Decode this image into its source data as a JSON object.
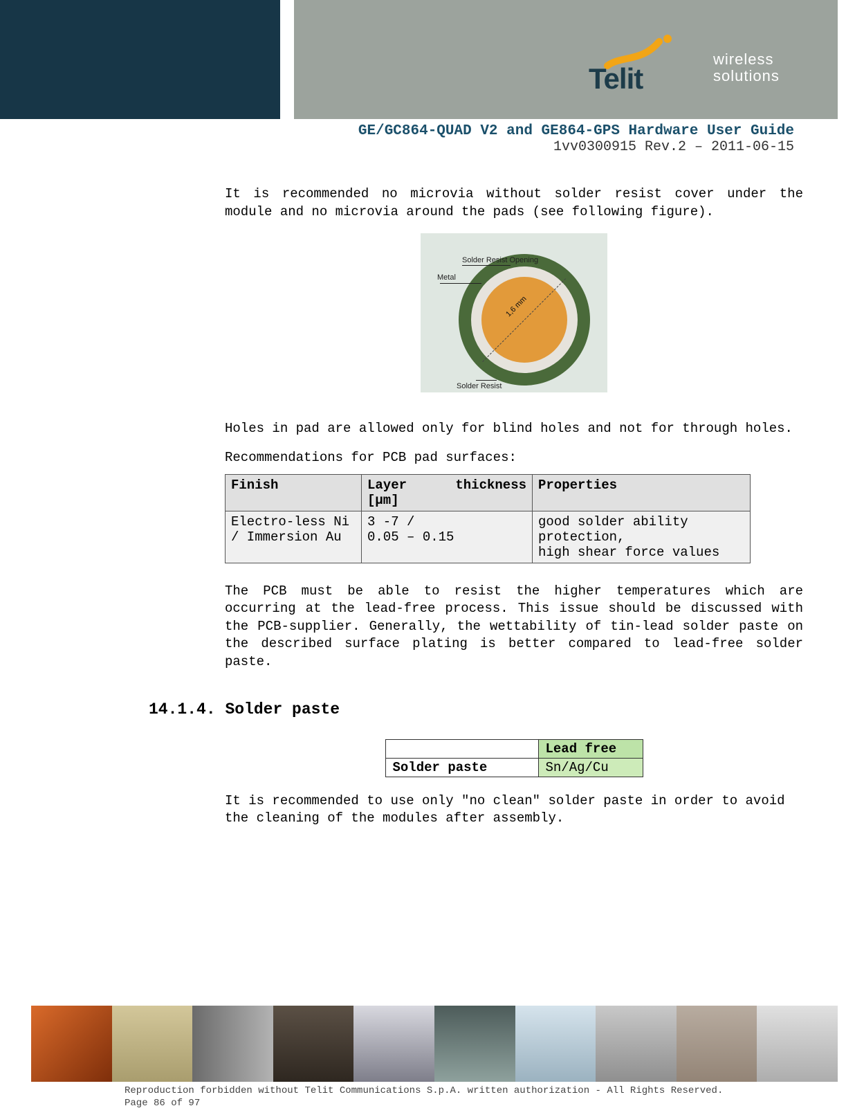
{
  "header": {
    "brand_name": "Telit",
    "brand_tag_line1": "wireless",
    "brand_tag_line2": "solutions",
    "doc_title": "GE/GC864-QUAD V2 and GE864-GPS Hardware User Guide",
    "doc_rev": "1vv0300915 Rev.2 – 2011-06-15"
  },
  "body": {
    "para1": "It is recommended no microvia without solder resist cover under the module and no microvia around the pads (see following figure).",
    "figure": {
      "label_sro": "Solder Resist Opening",
      "label_metal": "Metal",
      "label_sr": "Solder Resist",
      "dimension": "1,6 mm"
    },
    "para2": "Holes in pad are allowed only for blind holes and not for through holes.",
    "para3": "Recommendations for PCB pad surfaces:",
    "table1": {
      "headers": {
        "finish": "Finish",
        "thickness": "Layer thickness [µm]",
        "properties": "Properties"
      },
      "rows": [
        {
          "finish": "Electro-less Ni / Immersion Au",
          "thickness": "3 -7 /\n0.05 – 0.15",
          "properties": "good solder ability protection,\nhigh shear force values"
        }
      ]
    },
    "para4": "The PCB must be able to resist the higher temperatures which are occurring at the lead-free process. This issue should be discussed with the PCB-supplier. Generally, the wettability of tin-lead solder paste on the described surface plating is better compared to lead-free solder paste.",
    "section_number": "14.1.4.",
    "section_title": "Solder paste",
    "table2": {
      "col2_header": "Lead free",
      "row_label": "Solder paste",
      "row_value": "Sn/Ag/Cu"
    },
    "para5": "It is recommended to use only \"no clean\" solder paste in order to avoid the cleaning of the modules after assembly."
  },
  "footer": {
    "copyright": "Reproduction forbidden without Telit Communications S.p.A. written authorization - All Rights Reserved.",
    "page": "Page 86 of 97"
  }
}
